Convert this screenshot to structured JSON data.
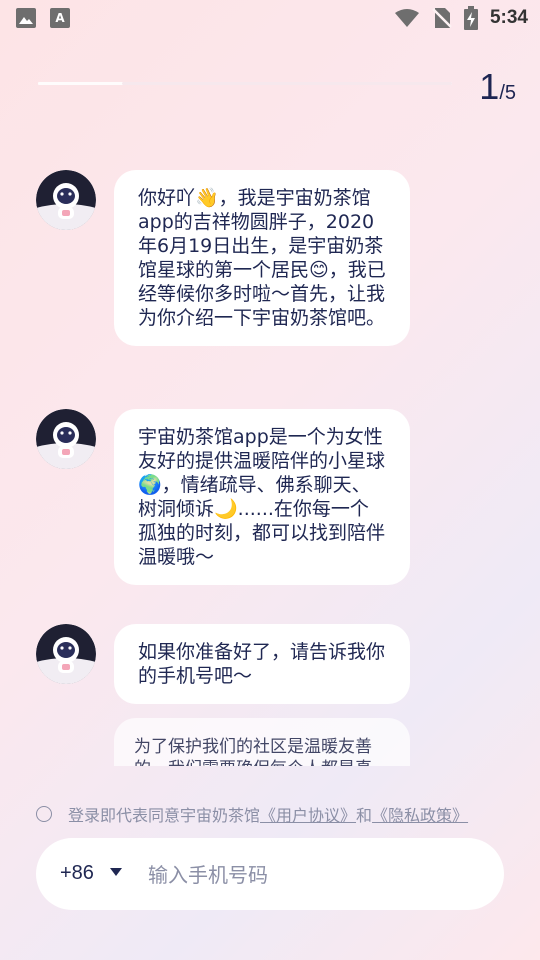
{
  "status_bar": {
    "time": "5:34",
    "left_icons": [
      "image-icon",
      "text-a-icon"
    ],
    "right_icons": [
      "wifi-icon",
      "no-sim-icon",
      "battery-charging-icon"
    ],
    "text_icon_letter": "A"
  },
  "progress": {
    "current": "1",
    "total": "/5",
    "fraction": 0.2
  },
  "messages": [
    {
      "text": "你好吖👋，我是宇宙奶茶馆app的吉祥物圆胖子，2020年6月19日出生，是宇宙奶茶馆星球的第一个居民😊，我已经等候你多时啦～首先，让我为你介绍一下宇宙奶茶馆吧。"
    },
    {
      "text": "宇宙奶茶馆app是一个为女性友好的提供温暖陪伴的小星球🌍，情绪疏导、佛系聊天、树洞倾诉🌙......在你每一个孤独的时刻，都可以找到陪伴温暖哦～"
    },
    {
      "text": "如果你准备好了，请告诉我你的手机号吧～"
    },
    {
      "text": "为了保护我们的社区是温暖友善的，我们需要确保每个人都是真"
    }
  ],
  "agreement": {
    "prefix": "登录即代表同意宇宙奶茶馆",
    "user_agreement": "《用户协议》",
    "and": "和",
    "privacy_policy": "《隐私政策》"
  },
  "phone": {
    "country_code": "+86",
    "placeholder": "输入手机号码",
    "value": ""
  }
}
